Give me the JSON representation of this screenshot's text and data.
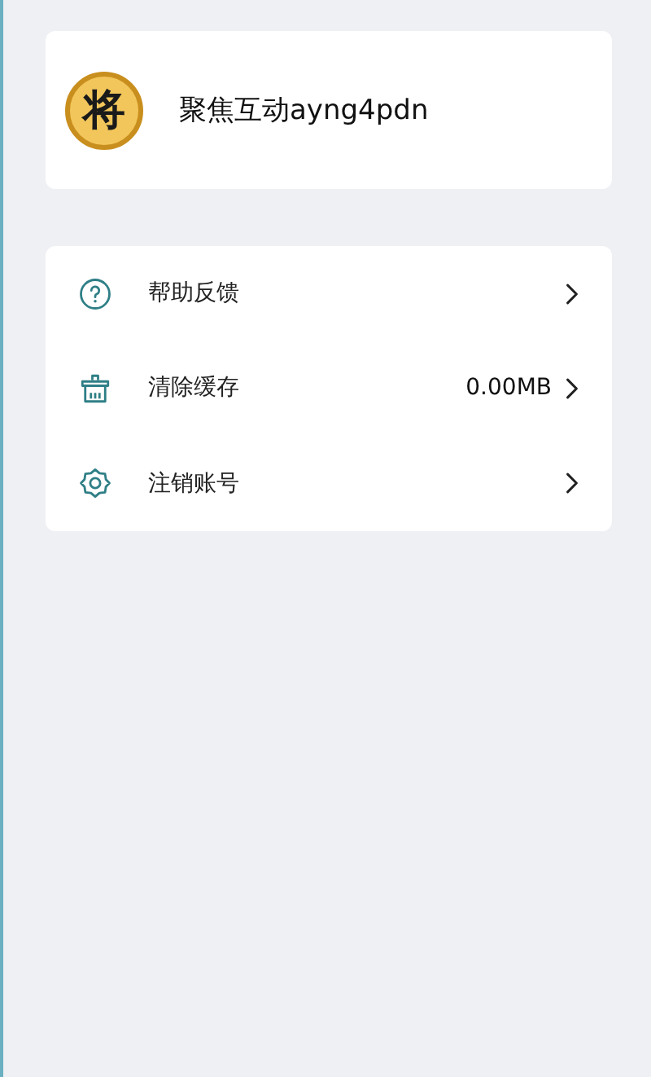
{
  "profile": {
    "avatar_glyph": "将",
    "name": "聚焦互动ayng4pdn"
  },
  "menu": [
    {
      "kind": "help",
      "label": "帮助反馈"
    },
    {
      "kind": "clean",
      "label": "清除缓存",
      "value": "0.00MB"
    },
    {
      "kind": "settings",
      "label": "注销账号"
    }
  ]
}
